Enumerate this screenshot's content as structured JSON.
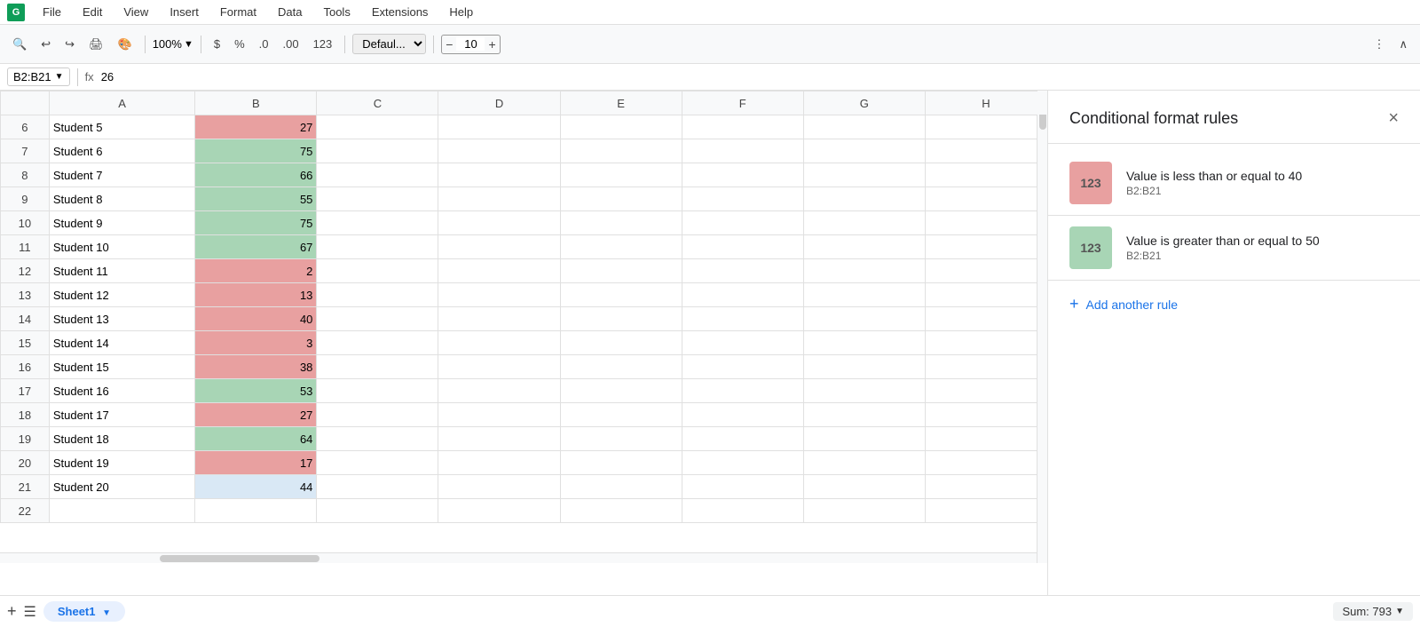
{
  "app": {
    "logo": "G",
    "menu_items": [
      "File",
      "Edit",
      "View",
      "Insert",
      "Format",
      "Data",
      "Tools",
      "Extensions",
      "Help"
    ]
  },
  "toolbar": {
    "zoom": "100%",
    "currency": "$",
    "percent": "%",
    "decimal_dec": ".0",
    "decimal_inc": ".00",
    "format_123": "123",
    "font": "Defaul...",
    "font_size": "10",
    "more_icon": "⋮",
    "collapse_icon": "∧"
  },
  "formula_bar": {
    "cell_ref": "B2:B21",
    "fx": "fx",
    "value": "26"
  },
  "spreadsheet": {
    "columns": [
      "",
      "A",
      "B",
      "C",
      "D",
      "E",
      "F",
      "G",
      "H"
    ],
    "rows": [
      {
        "row": 6,
        "col_a": "Student 5",
        "col_b": 27,
        "color": "red"
      },
      {
        "row": 7,
        "col_a": "Student 6",
        "col_b": 75,
        "color": "green"
      },
      {
        "row": 8,
        "col_a": "Student 7",
        "col_b": 66,
        "color": "green"
      },
      {
        "row": 9,
        "col_a": "Student 8",
        "col_b": 55,
        "color": "green"
      },
      {
        "row": 10,
        "col_a": "Student 9",
        "col_b": 75,
        "color": "green"
      },
      {
        "row": 11,
        "col_a": "Student 10",
        "col_b": 67,
        "color": "green"
      },
      {
        "row": 12,
        "col_a": "Student 11",
        "col_b": 2,
        "color": "red"
      },
      {
        "row": 13,
        "col_a": "Student 12",
        "col_b": 13,
        "color": "red"
      },
      {
        "row": 14,
        "col_a": "Student 13",
        "col_b": 40,
        "color": "red"
      },
      {
        "row": 15,
        "col_a": "Student 14",
        "col_b": 3,
        "color": "red"
      },
      {
        "row": 16,
        "col_a": "Student 15",
        "col_b": 38,
        "color": "red"
      },
      {
        "row": 17,
        "col_a": "Student 16",
        "col_b": 53,
        "color": "green"
      },
      {
        "row": 18,
        "col_a": "Student 17",
        "col_b": 27,
        "color": "red"
      },
      {
        "row": 19,
        "col_a": "Student 18",
        "col_b": 64,
        "color": "green"
      },
      {
        "row": 20,
        "col_a": "Student 19",
        "col_b": 17,
        "color": "red"
      },
      {
        "row": 21,
        "col_a": "Student 20",
        "col_b": 44,
        "color": "neutral"
      }
    ]
  },
  "bottom_bar": {
    "add_sheet": "+",
    "menu": "☰",
    "sheet_name": "Sheet1",
    "sum_label": "Sum: 793"
  },
  "right_panel": {
    "title": "Conditional format rules",
    "close_icon": "×",
    "rules": [
      {
        "condition": "Value is less than or equal to 40",
        "range": "B2:B21",
        "preview_text": "123",
        "color_class": "red"
      },
      {
        "condition": "Value is greater than or equal to 50",
        "range": "B2:B21",
        "preview_text": "123",
        "color_class": "green"
      }
    ],
    "add_rule_label": "Add another rule"
  }
}
